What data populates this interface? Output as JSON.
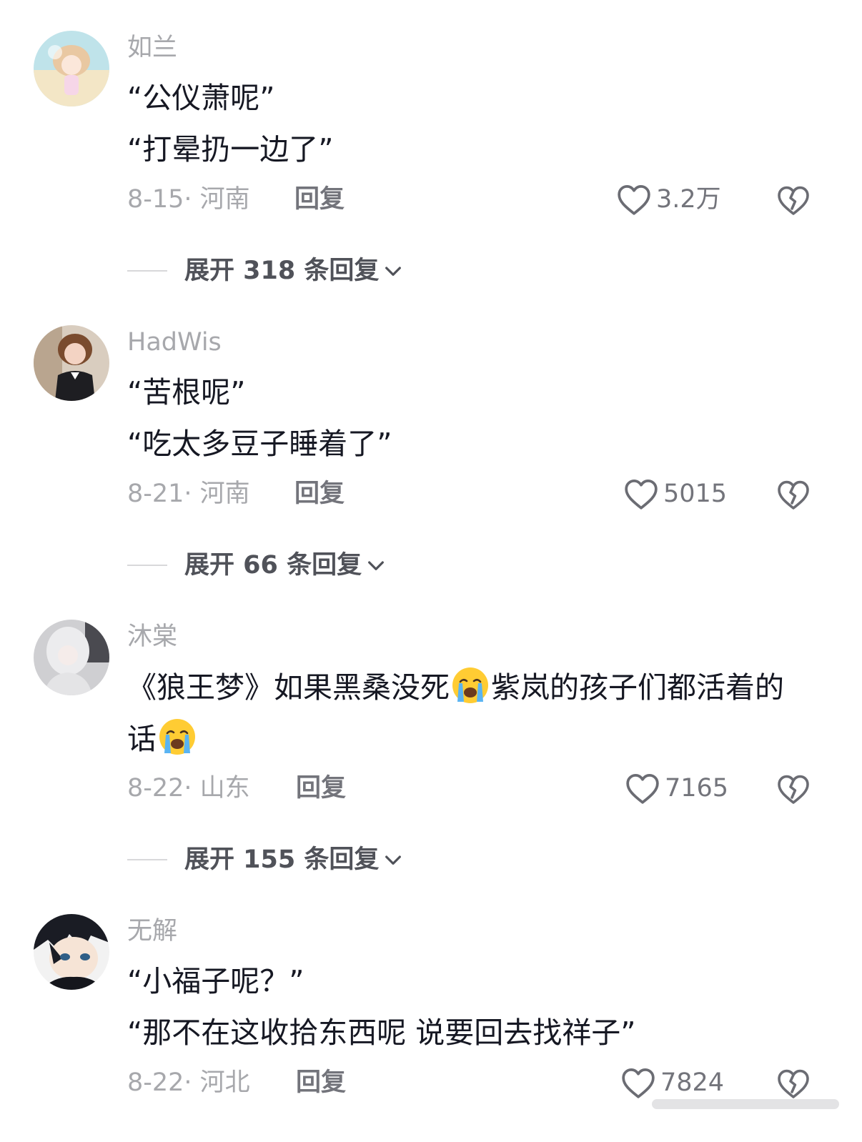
{
  "comments": [
    {
      "username": "如兰",
      "lines": [
        "“公仪萧呢”",
        "“打晕扔一边了”"
      ],
      "date_location": "8-15· 河南",
      "reply_label": "回复",
      "likes": "3.2万",
      "expand_label": "展开 318 条回复"
    },
    {
      "username": "HadWis",
      "lines": [
        "“苦根呢”",
        "“吃太多豆子睡着了”"
      ],
      "date_location": "8-21· 河南",
      "reply_label": "回复",
      "likes": "5015",
      "expand_label": "展开 66 条回复"
    },
    {
      "username": "沐棠",
      "text_part1": "《狼王梦》如果黑桑没死",
      "text_part2": "紫岚的孩子们都活着的话",
      "date_location": "8-22· 山东",
      "reply_label": "回复",
      "likes": "7165",
      "expand_label": "展开 155 条回复"
    },
    {
      "username": "无解",
      "lines": [
        "“小福子呢？”",
        "“那不在这收拾东西呢 说要回去找祥子”"
      ],
      "date_location": "8-22· 河北",
      "reply_label": "回复",
      "likes": "7824"
    }
  ],
  "icons": {
    "like": "heart-outline-icon",
    "dislike": "broken-heart-icon",
    "expand": "chevron-down-icon",
    "emoji": "loudly-crying-face-emoji"
  },
  "colors": {
    "background": "#ffffff",
    "text_primary": "#161823",
    "text_secondary": "#a7a8ac",
    "action_text": "#73747b"
  }
}
